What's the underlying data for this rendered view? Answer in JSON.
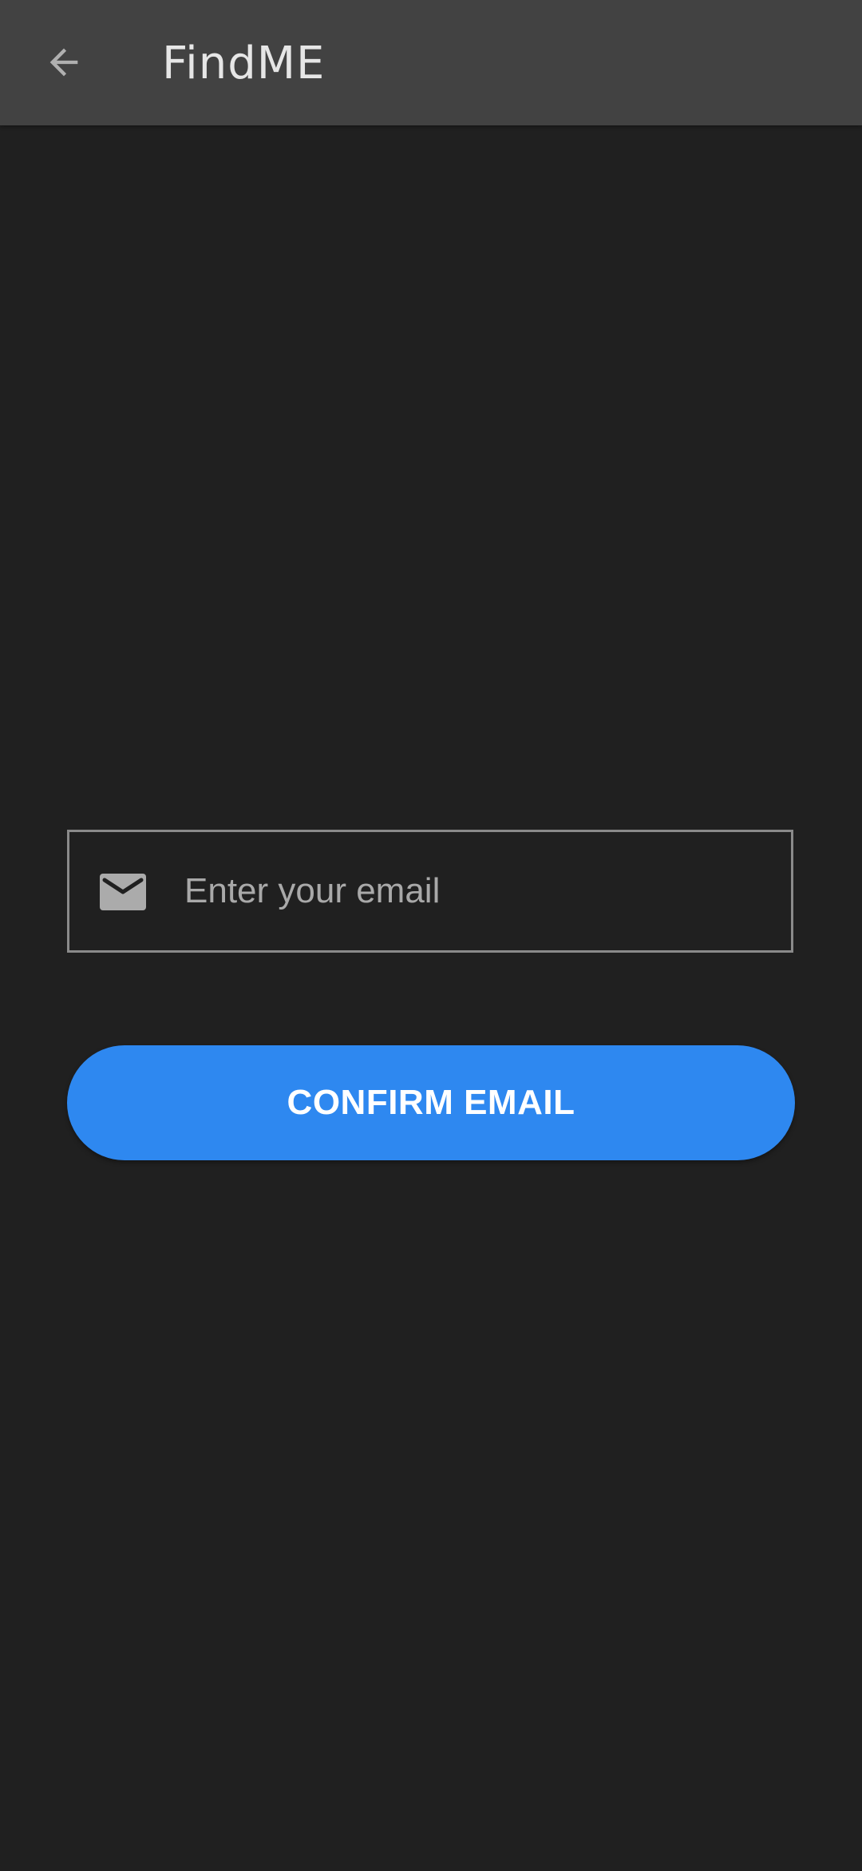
{
  "app_bar": {
    "title": "FindME",
    "back_icon": "arrow-back-icon"
  },
  "email_field": {
    "icon": "mail-icon",
    "placeholder": "Enter your email",
    "value": ""
  },
  "confirm_button": {
    "label": "CONFIRM EMAIL"
  },
  "colors": {
    "background": "#202020",
    "app_bar": "#424242",
    "accent": "#2e88f0",
    "field_border": "#8a8a8a",
    "placeholder": "#a9a9a9"
  }
}
